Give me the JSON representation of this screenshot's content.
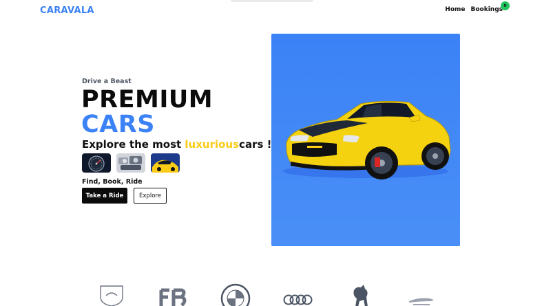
{
  "brand": {
    "name": "CARAVALA",
    "color": "#3b82f6"
  },
  "nav": {
    "items": [
      {
        "label": "Home"
      },
      {
        "label": "Bookings",
        "badge": "0"
      }
    ]
  },
  "hero": {
    "tagline": "Drive a Beast",
    "title_line1": "PREMIUM",
    "title_line2": "CARS",
    "subtitle_prefix": "Explore the most ",
    "subtitle_highlight": "luxurious",
    "subtitle_suffix": "cars !",
    "thumbnails": [
      "speedometer-thumbnail",
      "engine-thumbnail",
      "yellow-car-interior-thumbnail"
    ],
    "find_text": "Find, Book, Ride",
    "primary_button": "Take a Ride",
    "secondary_button": "Explore"
  },
  "logos": [
    "lamborghini-logo",
    "bugatti-logo",
    "bmw-logo",
    "audi-logo",
    "ferrari-logo",
    "jaguar-logo"
  ],
  "colors": {
    "accent_blue": "#3b82f6",
    "highlight_yellow": "#facc15",
    "badge_green": "#22c55e",
    "dark": "#0b0b0b"
  }
}
